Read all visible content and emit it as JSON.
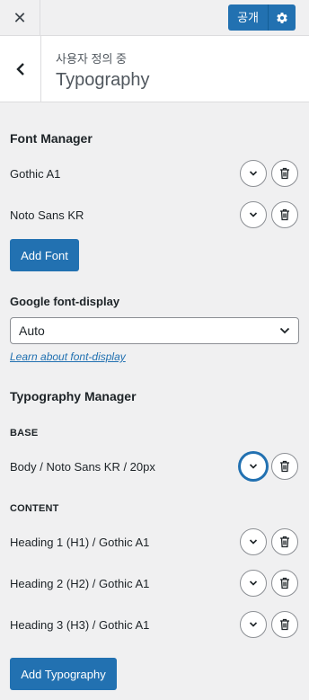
{
  "topbar": {
    "close_label": "✕",
    "publish_label": "공개"
  },
  "header": {
    "breadcrumb": "사용자 정의 중",
    "title": "Typography"
  },
  "font_manager": {
    "heading": "Font Manager",
    "fonts": [
      "Gothic A1",
      "Noto Sans KR"
    ],
    "add_label": "Add Font"
  },
  "font_display": {
    "label": "Google font-display",
    "selected": "Auto",
    "link": "Learn about font-display"
  },
  "typography_manager": {
    "heading": "Typography Manager",
    "base_label": "BASE",
    "base_items": [
      "Body / Noto Sans KR / 20px"
    ],
    "content_label": "CONTENT",
    "content_items": [
      "Heading 1 (H1) / Gothic A1",
      "Heading 2 (H2) / Gothic A1",
      "Heading 3 (H3) / Gothic A1"
    ],
    "add_label": "Add Typography"
  }
}
